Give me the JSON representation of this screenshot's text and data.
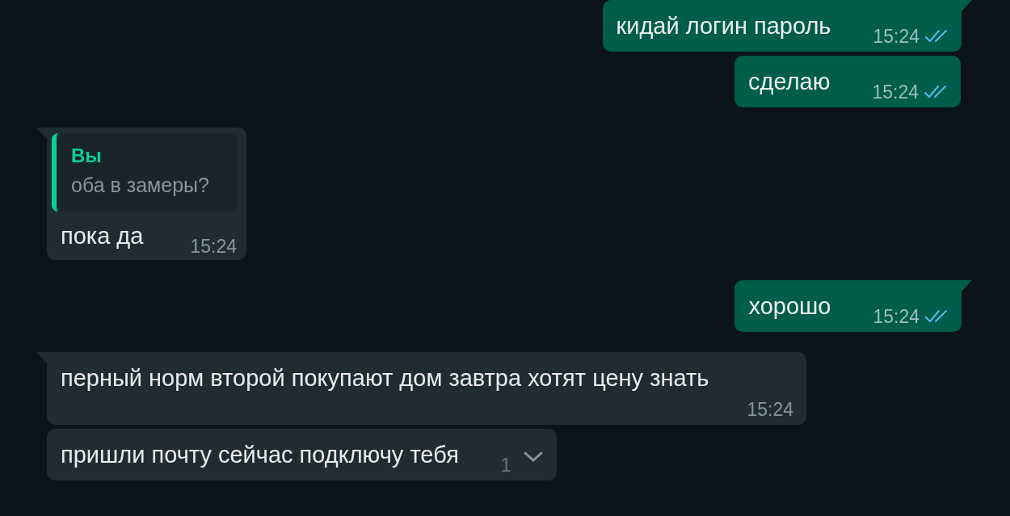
{
  "messages": [
    {
      "outgoing": true,
      "text": "кидай логин пароль",
      "time": "15:24",
      "read": true
    },
    {
      "outgoing": true,
      "text": "сделаю",
      "time": "15:24",
      "read": true
    },
    {
      "outgoing": false,
      "reply": {
        "author": "Вы",
        "text": "оба в замеры?"
      },
      "text": "пока да",
      "time": "15:24"
    },
    {
      "outgoing": true,
      "text": "хорошо",
      "time": "15:24",
      "read": true
    },
    {
      "outgoing": false,
      "text": "перный норм второй покупают дом завтра хотят цену знать",
      "time": "15:24"
    },
    {
      "outgoing": false,
      "text": "пришли почту сейчас подключу тебя",
      "time": "1",
      "hovered": true
    }
  ]
}
